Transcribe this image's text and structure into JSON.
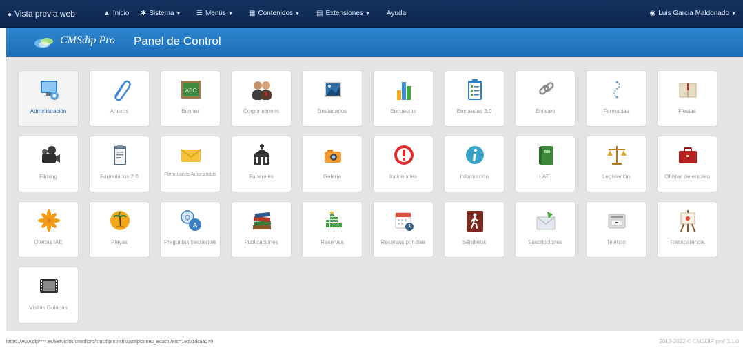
{
  "topnav": {
    "preview": "Vista previa web",
    "inicio": "Inicio",
    "sistema": "Sistema",
    "menus": "Menús",
    "contenidos": "Contenidos",
    "extensiones": "Extensiones",
    "ayuda": "Ayuda",
    "user": "Luis Garcia Maldonado"
  },
  "banner": {
    "brand": "CMSdip Pro",
    "title": "Panel de Control"
  },
  "tiles": [
    {
      "label": "Administración",
      "icon": "administration-icon"
    },
    {
      "label": "Anexos",
      "icon": "paperclip-icon"
    },
    {
      "label": "Banner",
      "icon": "banner-icon"
    },
    {
      "label": "Corporaciones",
      "icon": "people-icon"
    },
    {
      "label": "Destacados",
      "icon": "picture-icon"
    },
    {
      "label": "Encuestas",
      "icon": "bar-chart-icon"
    },
    {
      "label": "Encuestas 2.0",
      "icon": "clipboard-checklist-icon"
    },
    {
      "label": "Enlaces",
      "icon": "chain-link-icon"
    },
    {
      "label": "Farmacias",
      "icon": "pharmacy-icon"
    },
    {
      "label": "Fiestas",
      "icon": "book-icon"
    },
    {
      "label": "Filming",
      "icon": "movie-camera-icon"
    },
    {
      "label": "Formularios 2.0",
      "icon": "form-icon"
    },
    {
      "label": "Formularios Autorizados",
      "icon": "envelope-icon"
    },
    {
      "label": "Funerales",
      "icon": "church-icon"
    },
    {
      "label": "Galería",
      "icon": "camera-icon"
    },
    {
      "label": "Incidencias",
      "icon": "alert-icon"
    },
    {
      "label": "Información",
      "icon": "info-icon"
    },
    {
      "label": "I.AE.",
      "icon": "notebook-icon"
    },
    {
      "label": "Legislación",
      "icon": "scales-icon"
    },
    {
      "label": "Ofertas de empleo",
      "icon": "briefcase-icon"
    },
    {
      "label": "Ofertas IAE",
      "icon": "star-burst-icon"
    },
    {
      "label": "Playas",
      "icon": "palm-tree-icon"
    },
    {
      "label": "Preguntas frecuentes",
      "icon": "qa-bubble-icon"
    },
    {
      "label": "Publicaciones",
      "icon": "books-icon"
    },
    {
      "label": "Reservas",
      "icon": "equalizer-icon"
    },
    {
      "label": "Reservas por días",
      "icon": "calendar-clock-icon"
    },
    {
      "label": "Senderos",
      "icon": "hiker-icon"
    },
    {
      "label": "Suscripciones",
      "icon": "mail-subscribe-icon"
    },
    {
      "label": "Teletipo",
      "icon": "teletype-icon"
    },
    {
      "label": "Transparencia",
      "icon": "easel-icon"
    },
    {
      "label": "Visitas Guiadas",
      "icon": "film-icon"
    }
  ],
  "status_url": "https://www.dip****.es/Servicios/cmsdipro/cmsdipro.nsf/suscripciones_ecusp?arc=1edv1dc9a240",
  "footer": "2013-2022 © CMSDIP prof 3.1.0"
}
